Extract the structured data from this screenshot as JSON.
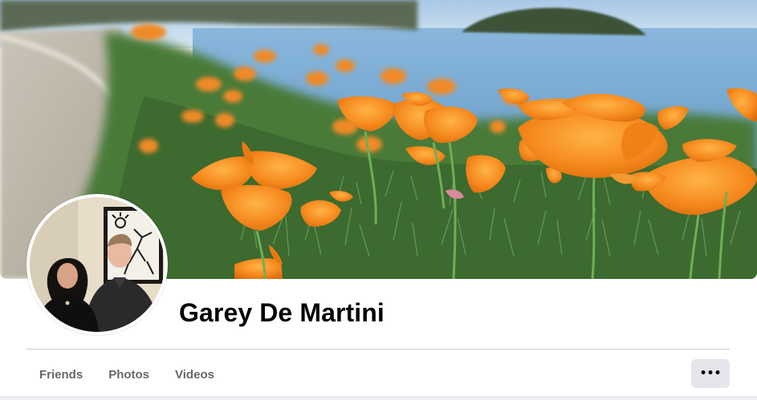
{
  "profile": {
    "name": "Garey De Martini"
  },
  "tabs": [
    {
      "label": "Friends"
    },
    {
      "label": "Photos"
    },
    {
      "label": "Videos"
    }
  ],
  "more_button": {
    "label": "•••",
    "icon": "more-horizontal-icon"
  },
  "cover_photo": {
    "icon": "cover-photo"
  },
  "avatar": {
    "icon": "profile-photo"
  },
  "colors": {
    "name_text": "#050505",
    "tab_text": "#65676b",
    "button_bg": "#e4e6eb",
    "divider": "#ced0d4",
    "poppy_orange": "#f28a1c",
    "sky": "#b9d6ee",
    "water": "#7fb0d8",
    "foliage": "#3f6b33"
  }
}
